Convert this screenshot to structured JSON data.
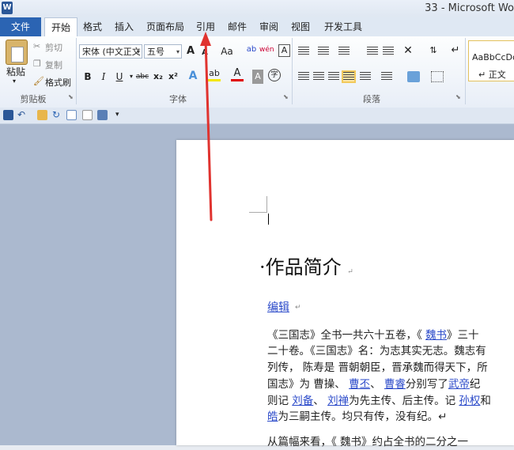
{
  "window": {
    "title": "33 - Microsoft Wo",
    "app_icon": "W"
  },
  "tabs": [
    {
      "label": "文件"
    },
    {
      "label": "开始"
    },
    {
      "label": "格式"
    },
    {
      "label": "插入"
    },
    {
      "label": "页面布局"
    },
    {
      "label": "引用"
    },
    {
      "label": "邮件"
    },
    {
      "label": "审阅"
    },
    {
      "label": "视图"
    },
    {
      "label": "开发工具"
    }
  ],
  "clipboard": {
    "paste": "粘贴",
    "cut": "剪切",
    "copy": "复制",
    "format_painter": "格式刷",
    "label": "剪贴板"
  },
  "font": {
    "name": "宋体 (中文正文",
    "size": "五号",
    "grow": "A",
    "shrink": "A",
    "case": "Aa",
    "clear": "ab",
    "phonetic": "wén",
    "border_char": "A",
    "bold": "B",
    "italic": "I",
    "underline": "U",
    "strike": "abc",
    "sub": "x₂",
    "sup": "x²",
    "effects": "A",
    "highlight": "ab",
    "color": "A",
    "shade": "A",
    "enclose": "字",
    "label": "字体"
  },
  "paragraph": {
    "label": "段落"
  },
  "styles": {
    "sample": "AaBbCcDc",
    "normal": "↵ 正文"
  },
  "document": {
    "cursor_mark": "↵",
    "heading": "·作品简介",
    "para_mark": "↵",
    "edit_link": "编辑",
    "lines": [
      [
        "《三国志》全书一共六十五卷，《 ",
        "魏书",
        "》三十"
      ],
      [
        "二十卷。《三国志》名：为志其实无志。魏志有"
      ],
      [
        "列传， 陈寿是 晋朝朝臣，晋承魏而得天下，所"
      ],
      [
        "国志》为 曹操、 ",
        "曹丕",
        "、 ",
        "曹睿",
        "分别写了",
        "武帝",
        "纪"
      ],
      [
        "则记 ",
        "刘备",
        "、 ",
        "刘禅",
        "为先主传、后主传。记 ",
        "孙权",
        "和"
      ],
      [
        "皓",
        "为三嗣主传。均只有传，没有纪。↵"
      ],
      [
        "从篇幅来看，《 魏书》约占全书的二分之一"
      ]
    ]
  },
  "colors": {
    "accent": "#2b64b3",
    "link": "#2a49c9",
    "arrow": "#e0332f"
  }
}
